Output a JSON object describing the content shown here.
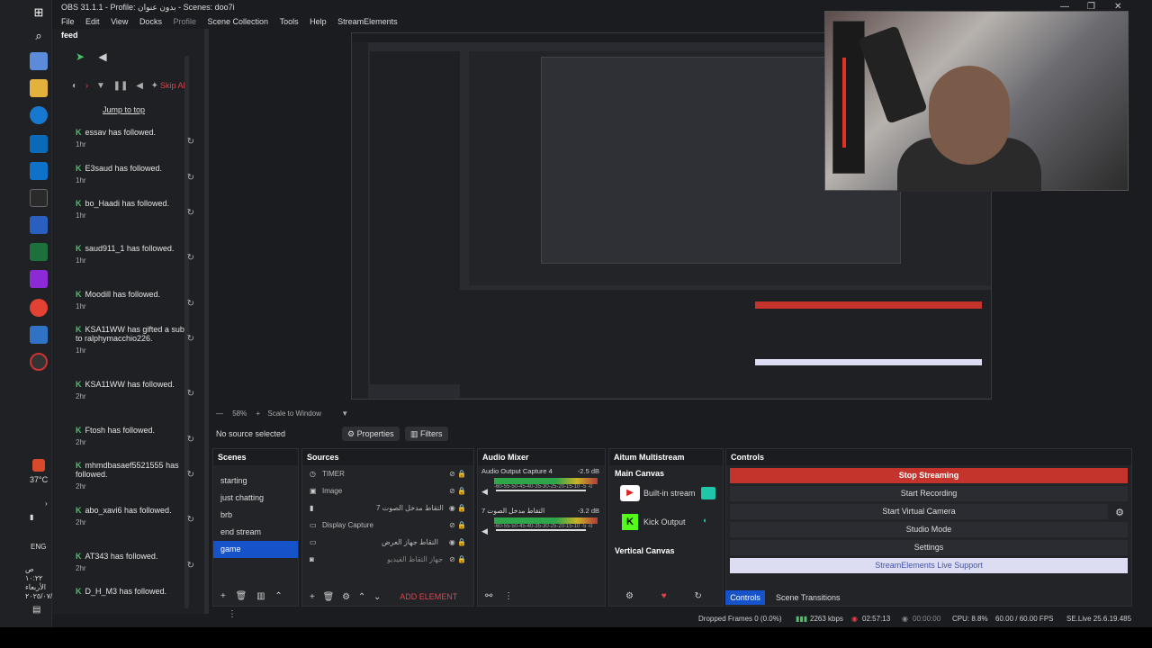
{
  "window": {
    "title": "OBS 31.1.1 - Profile: بدون عنوان - Scenes: doo7i"
  },
  "menu": [
    "File",
    "Edit",
    "View",
    "Docks",
    "Profile",
    "Scene Collection",
    "Tools",
    "Help",
    "StreamElements"
  ],
  "feed": {
    "title": "feed",
    "skip_label": "Skip Ale",
    "jump_label": "Jump to top",
    "items": [
      {
        "text": "essav has followed.",
        "time": "1hr"
      },
      {
        "text": "E3saud has followed.",
        "time": "1hr"
      },
      {
        "text": "bo_Haadi has followed.",
        "time": "1hr"
      },
      {
        "text": "saud911_1 has followed.",
        "time": "1hr"
      },
      {
        "text": "Moodill has followed.",
        "time": "1hr"
      },
      {
        "text": "KSA11WW has gifted a sub to ralphymacchio226.",
        "time": "1hr"
      },
      {
        "text": "KSA11WW has followed.",
        "time": "2hr"
      },
      {
        "text": "Ftosh has followed.",
        "time": "2hr"
      },
      {
        "text": "mhmdbasaef5521555 has followed.",
        "time": "2hr"
      },
      {
        "text": "abo_xavi6 has followed.",
        "time": "2hr"
      },
      {
        "text": "AT343 has followed.",
        "time": "2hr"
      },
      {
        "text": "D_H_M3 has followed.",
        "time": ""
      }
    ]
  },
  "preview": {
    "zoom": "58%",
    "scale_label": "Scale to Window"
  },
  "properties": {
    "no_source": "No source selected",
    "properties_btn": "Properties",
    "filters_btn": "Filters"
  },
  "scenes": {
    "title": "Scenes",
    "items": [
      "starting",
      "just chatting",
      "brb",
      "end stream",
      "game"
    ],
    "active": "game"
  },
  "sources": {
    "title": "Sources",
    "items": [
      "TIMER",
      "Image",
      "التقاط مدخل الصوت 7",
      "Display Capture",
      "التقاط جهاز العرض",
      "جهاز التقاط الفيديو"
    ],
    "add_element": "ADD ELEMENT"
  },
  "mixer": {
    "title": "Audio Mixer",
    "channels": [
      {
        "name": "Audio Output Capture 4",
        "db": "-2.5 dB",
        "scale": "-60-55-50-45-40-35-30-25-20-15-10 -5 -0"
      },
      {
        "name": "7 التقاط مدخل الصوت",
        "db": "-3.2 dB",
        "scale": "-60-55-50-45-40-35-30-25-20-15-10 -5 -0"
      }
    ]
  },
  "multistream": {
    "title": "Aitum Multistream",
    "main_canvas": "Main Canvas",
    "builtin": "Built-in stream",
    "kick": "Kick Output",
    "vertical_canvas": "Vertical Canvas"
  },
  "controls": {
    "title": "Controls",
    "stop_streaming": "Stop Streaming",
    "start_recording": "Start Recording",
    "start_virtual_camera": "Start Virtual Camera",
    "studio_mode": "Studio Mode",
    "settings": "Settings",
    "se_support": "StreamElements Live Support",
    "tab_controls": "Controls",
    "tab_transitions": "Scene Transitions"
  },
  "status": {
    "dropped": "Dropped Frames 0 (0.0%)",
    "kbps": "2263 kbps",
    "live_time": "02:57:13",
    "rec_time": "00:00:00",
    "cpu": "CPU: 8.8%",
    "fps": "60.00 / 60.00 FPS",
    "se": "SE.Live 25.6.19.485"
  },
  "taskbar": {
    "temp": "37°C",
    "lang": "ENG",
    "clock": "ص ١٠:٢٢",
    "day": "الأربعاء",
    "date": "٢٠٢٥/٠٧/٢٣"
  },
  "colors": {
    "accent": "#1652c9",
    "stop": "#c4342d",
    "feed_icon": "#4ac26b"
  }
}
